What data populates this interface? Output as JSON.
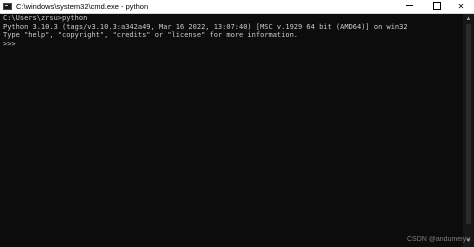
{
  "window": {
    "title": "C:\\windows\\system32\\cmd.exe - python",
    "controls": {
      "minimize_icon": "minimize-icon",
      "maximize_icon": "maximize-icon",
      "close_icon": "close-icon",
      "close_glyph": "✕"
    }
  },
  "terminal": {
    "lines": [
      "C:\\Users\\zrsu>python",
      "Python 3.10.3 (tags/v3.10.3:a342a49, Mar 16 2022, 13:07:40) [MSC v.1929 64 bit (AMD64)] on win32",
      "Type \"help\", \"copyright\", \"credits\" or \"license\" for more information.",
      ">>>"
    ],
    "background": "#0c0c0c",
    "text_color": "#cccccc"
  },
  "scrollbar": {
    "up_glyph": "▲",
    "down_glyph": "▼"
  },
  "watermark": {
    "text": "CSDN @andumeiyu"
  }
}
